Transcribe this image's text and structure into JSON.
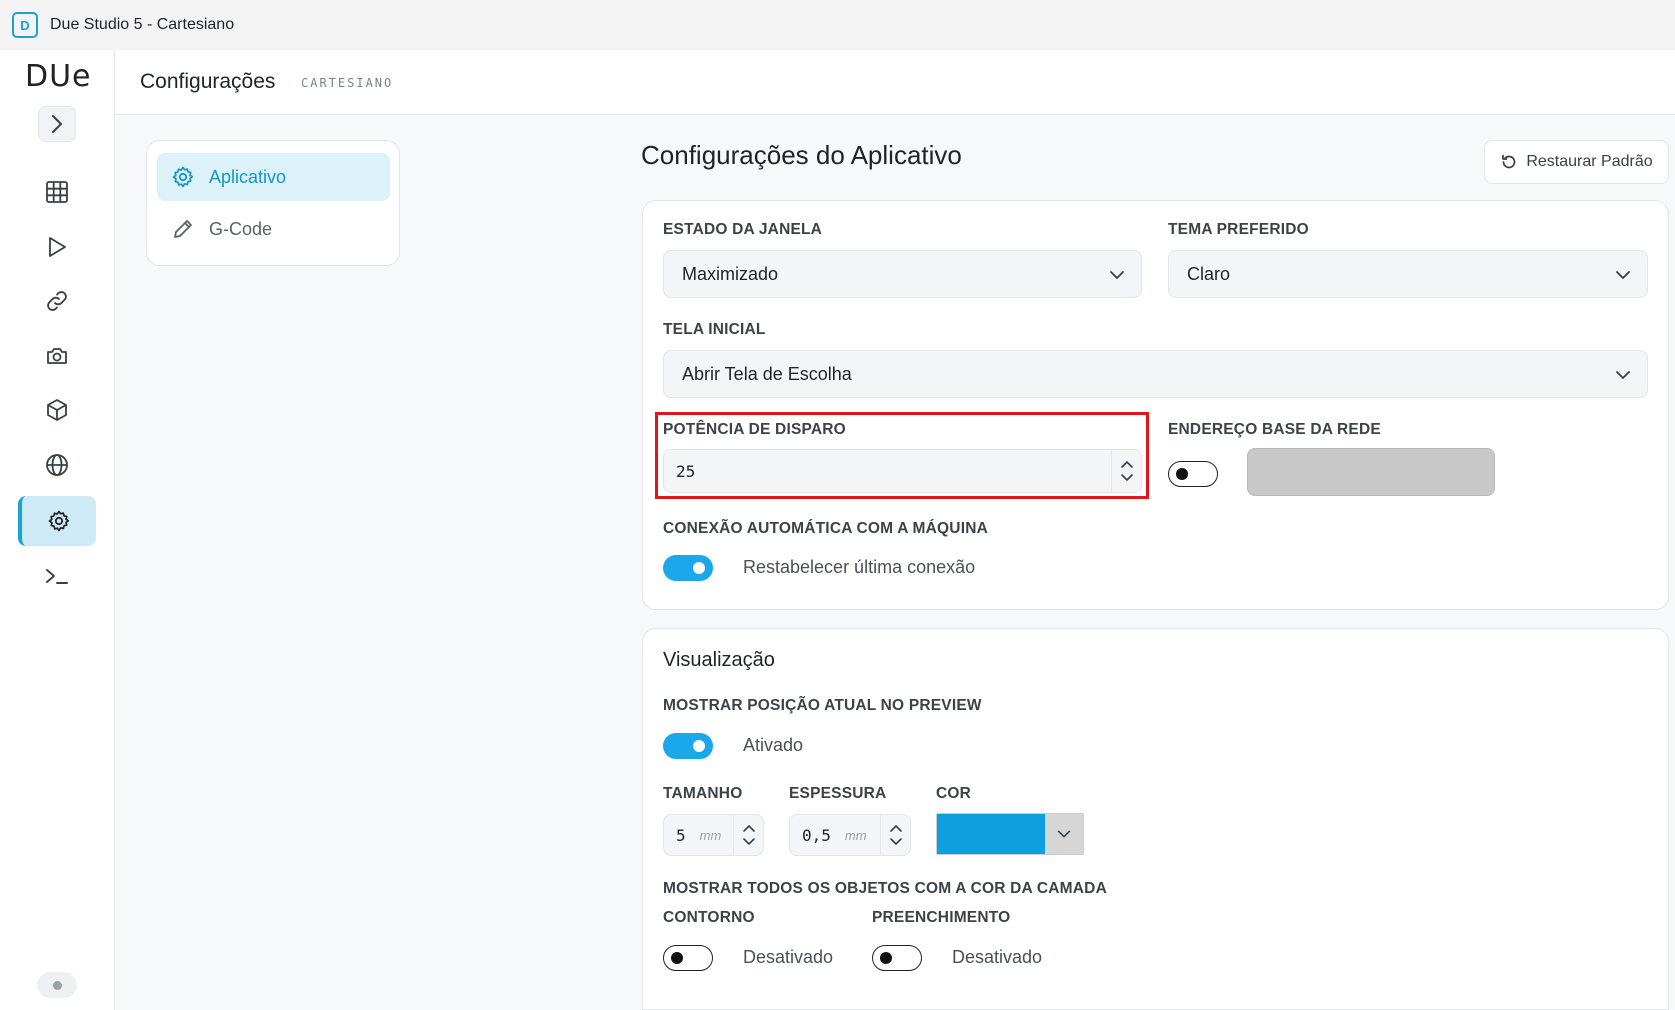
{
  "window": {
    "title": "Due Studio 5 - Cartesiano"
  },
  "sidebar": {
    "logo": "DUe",
    "items": [
      {
        "icon": "grid-icon"
      },
      {
        "icon": "play-icon"
      },
      {
        "icon": "link-icon"
      },
      {
        "icon": "camera-icon"
      },
      {
        "icon": "cube-icon"
      },
      {
        "icon": "globe-icon"
      },
      {
        "icon": "gear-icon",
        "active": true
      },
      {
        "icon": "terminal-icon"
      }
    ]
  },
  "header": {
    "title": "Configurações",
    "subtitle": "CARTESIANO"
  },
  "settings_menu": {
    "items": [
      {
        "label": "Aplicativo",
        "icon": "gear-icon",
        "active": true
      },
      {
        "label": "G-Code",
        "icon": "pencil-icon",
        "active": false
      }
    ]
  },
  "page": {
    "title": "Configurações do Aplicativo",
    "restore_label": "Restaurar Padrão"
  },
  "app_settings": {
    "window_state": {
      "label": "ESTADO DA JANELA",
      "value": "Maximizado"
    },
    "theme": {
      "label": "TEMA PREFERIDO",
      "value": "Claro"
    },
    "start_screen": {
      "label": "TELA INICIAL",
      "value": "Abrir Tela de Escolha"
    },
    "fire_power": {
      "label": "POTÊNCIA DE DISPARO",
      "value": "25"
    },
    "network_base": {
      "label": "ENDEREÇO BASE DA REDE",
      "enabled": false,
      "value": ""
    },
    "auto_connect": {
      "label": "CONEXÃO AUTOMÁTICA COM A MÁQUINA",
      "enabled": true,
      "text": "Restabelecer última conexão"
    }
  },
  "visualization": {
    "title": "Visualização",
    "show_position": {
      "label": "MOSTRAR POSIÇÃO ATUAL NO PREVIEW",
      "enabled": true,
      "text": "Ativado"
    },
    "size": {
      "label": "TAMANHO",
      "value": "5",
      "unit": "mm"
    },
    "thickness": {
      "label": "ESPESSURA",
      "value": "0,5",
      "unit": "mm"
    },
    "color": {
      "label": "COR",
      "value": "#0f9ee0"
    },
    "layer_color": {
      "label": "MOSTRAR TODOS OS OBJETOS COM A COR DA CAMADA"
    },
    "outline": {
      "label": "CONTORNO",
      "enabled": false,
      "text": "Desativado"
    },
    "fill": {
      "label": "PREENCHIMENTO",
      "enabled": false,
      "text": "Desativado"
    }
  },
  "colors": {
    "accent": "#1aa7ec",
    "highlight": "#e0161e"
  }
}
